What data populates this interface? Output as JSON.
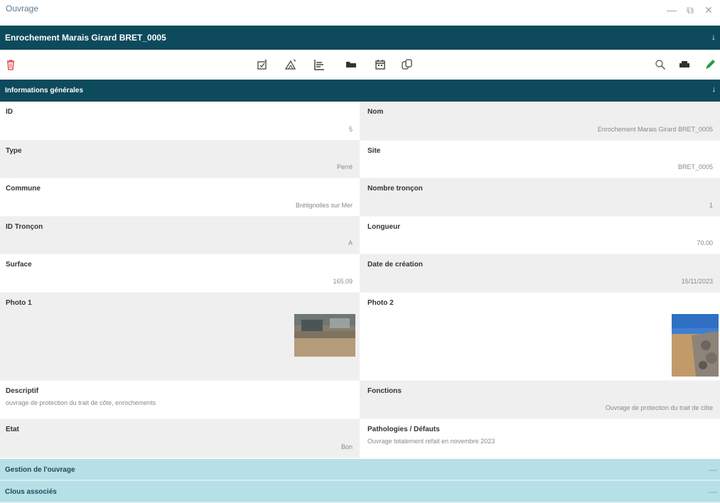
{
  "window": {
    "title": "Ouvrage",
    "controls": {
      "minimize": "—",
      "restore": "⧉",
      "close": "✕"
    }
  },
  "header": {
    "title": "Enrochement Marais Girard BRET_0005",
    "collapse_glyph": "↓"
  },
  "toolbar": {
    "icons": {
      "delete": "trash-icon",
      "edit_form": "edit-form-icon",
      "measure": "measure-icon",
      "profile": "chart-profile-icon",
      "folder": "folder-icon",
      "calendar": "calendar-icon",
      "copy": "copy-icon",
      "search": "search-icon",
      "print": "print-icon",
      "edit": "pencil-icon"
    },
    "colors": {
      "delete": "#e05a5a",
      "edit": "#2e9b3a",
      "default": "#333333"
    }
  },
  "general_section": {
    "label": "Informations générales",
    "collapse_glyph": "↓"
  },
  "fields": {
    "id": {
      "label": "ID",
      "value": "5"
    },
    "nom": {
      "label": "Nom",
      "value": "Enrochement Marais Girard BRET_0005"
    },
    "type": {
      "label": "Type",
      "value": "Perré"
    },
    "site": {
      "label": "Site",
      "value": "BRET_0005"
    },
    "commune": {
      "label": "Commune",
      "value": "Brétignolles sur Mer"
    },
    "nombre_troncon": {
      "label": "Nombre tronçon",
      "value": "1"
    },
    "id_troncon": {
      "label": "ID Tronçon",
      "value": "A"
    },
    "longueur": {
      "label": "Longueur",
      "value": "70.00"
    },
    "surface": {
      "label": "Surface",
      "value": "165.09"
    },
    "date_creation": {
      "label": "Date de création",
      "value": "15/11/2023"
    },
    "photo1": {
      "label": "Photo 1"
    },
    "photo2": {
      "label": "Photo 2"
    },
    "descriptif": {
      "label": "Descriptif",
      "value": "ouvrage de protection du trait de côte, enrochements"
    },
    "fonctions": {
      "label": "Fonctions",
      "value": "Ouvrage de protection du trait de côte"
    },
    "etat": {
      "label": "Etat",
      "value": "Bon"
    },
    "pathologies": {
      "label": "Pathologies / Défauts",
      "value": "Ouvrage totalement refait en novembre 2023"
    }
  },
  "sections_collapsed": [
    {
      "label": "Gestion de l'ouvrage",
      "glyph": "—"
    },
    {
      "label": "Clous associés",
      "glyph": "—"
    }
  ],
  "colors": {
    "header_dark": "#0d4a5c",
    "section_light": "#b6dfe7",
    "row_grey": "#efefef"
  }
}
